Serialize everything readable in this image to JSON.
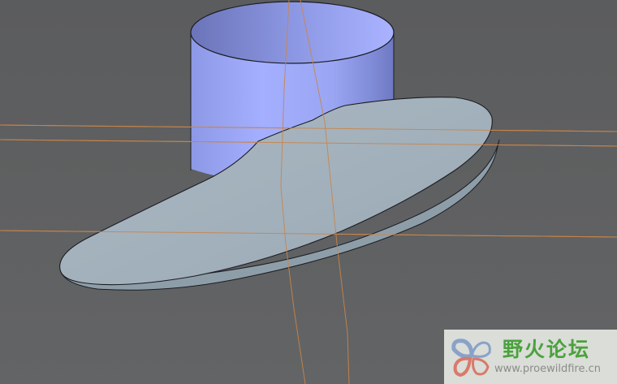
{
  "viewport": {
    "background_color": "#5e5f60",
    "datum_curve_color": "#c9854a",
    "cylinder_color": "#9aa6f2",
    "surface_color": "#a4b2bd"
  },
  "watermark": {
    "title": "野火论坛",
    "url": "www.proewildfire.cn",
    "logo_icon": "butterfly-logo-icon",
    "title_color": "#4aa23c"
  }
}
